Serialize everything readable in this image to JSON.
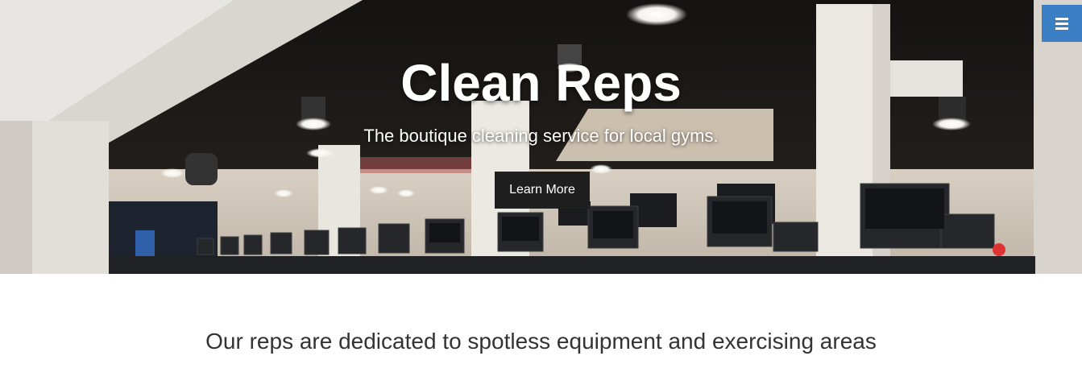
{
  "hero": {
    "title": "Clean Reps",
    "subtitle": "The boutique cleaning service for local gyms.",
    "cta_label": "Learn More",
    "background_image": "gym-treadmills-photo"
  },
  "menu": {
    "icon": "hamburger-menu-icon",
    "color": "#3a7fc4"
  },
  "intro": {
    "tagline": "Our reps are dedicated to spotless equipment and exercising areas"
  },
  "colors": {
    "button_bg": "#1f1f1f",
    "tagline_text": "#333333"
  }
}
